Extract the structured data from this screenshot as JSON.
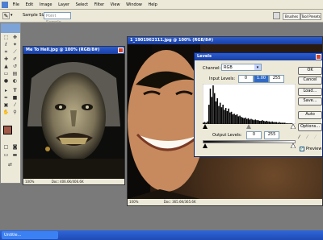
{
  "menu": {
    "file_label": "File",
    "edit_label": "Edit",
    "image_label": "Image",
    "layer_label": "Layer",
    "select_label": "Select",
    "filter_label": "Filter",
    "view_label": "View",
    "window_label": "Window",
    "help_label": "Help"
  },
  "options_bar": {
    "sample_size_label": "Sample Size:",
    "sample_size_value": "Point Sample",
    "tab_brushes": "Brushes",
    "tab_tool_presets": "Tool Presets"
  },
  "doc1": {
    "title": "Me To Hell.jpg @ 100% (RGB/8#)",
    "zoom": "100%",
    "status": "Doc: 406.6K/406.6K"
  },
  "doc2": {
    "title": "1_1901962111.jpg @ 100% (RGB/8#)",
    "zoom": "100%",
    "status": "Doc: 365.6K/365.6K"
  },
  "levels": {
    "title": "Levels",
    "channel_label": "Channel:",
    "channel_value": "RGB",
    "input_levels_label": "Input Levels:",
    "input_black": "0",
    "input_gamma": "1.00",
    "input_white": "255",
    "output_levels_label": "Output Levels:",
    "output_black": "0",
    "output_white": "255",
    "ok_label": "OK",
    "cancel_label": "Cancel",
    "load_label": "Load...",
    "save_label": "Save...",
    "auto_label": "Auto",
    "options_label": "Options...",
    "preview_label": "Preview",
    "preview_checked": true,
    "histogram": [
      2,
      3,
      2,
      4,
      30,
      55,
      42,
      60,
      48,
      35,
      40,
      28,
      33,
      26,
      30,
      22,
      25,
      20,
      24,
      18,
      19,
      15,
      16,
      14,
      15,
      12,
      13,
      11,
      10,
      9,
      10,
      8,
      9,
      7,
      8,
      7,
      6,
      7,
      6,
      6,
      5,
      5,
      6,
      5,
      4,
      5,
      4,
      4,
      3,
      4,
      3,
      3,
      3,
      2,
      3,
      2,
      2,
      2,
      2,
      1,
      1,
      1,
      1,
      1,
      0,
      0
    ]
  },
  "taskbar": {
    "item_label": "Untitle..."
  }
}
